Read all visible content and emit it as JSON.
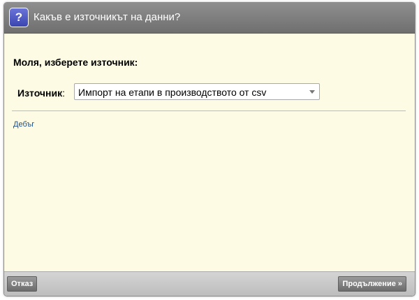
{
  "dialog": {
    "title": "Какъв е източникът на данни?",
    "help_icon_glyph": "?"
  },
  "form": {
    "heading": "Моля, изберете източник:",
    "source_label": "Източник",
    "source_colon": ":",
    "source_selected": "Импорт на етапи в производството от csv"
  },
  "links": {
    "debug": "Дебъг"
  },
  "footer": {
    "cancel_label": "Отказ",
    "continue_label": "Продължение »"
  },
  "colors": {
    "background": "#fdfbe3",
    "titlebar": "#7f7f7f",
    "help_icon": "#4a55c4",
    "link": "#1a4e8c"
  },
  "icons": [
    "help-icon",
    "chevron-down-icon"
  ]
}
